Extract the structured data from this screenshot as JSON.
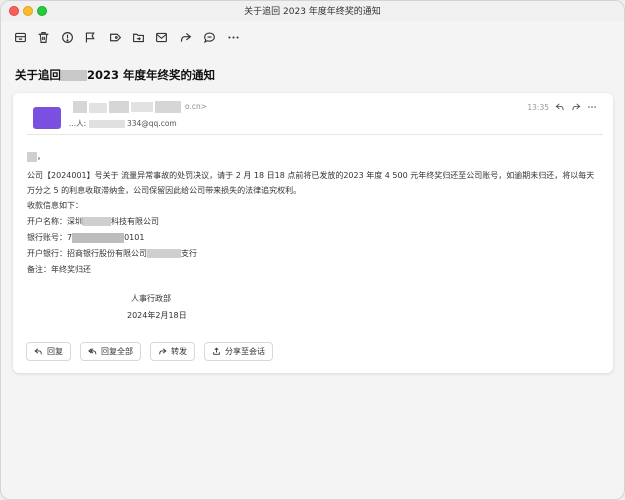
{
  "window": {
    "title": "关于追回 2023 年度年终奖的通知"
  },
  "toolbar": {
    "items": [
      {
        "name": "archive-icon"
      },
      {
        "name": "trash-icon"
      },
      {
        "name": "spam-icon"
      },
      {
        "name": "flag-icon"
      },
      {
        "name": "tag-icon"
      },
      {
        "name": "move-to-folder-icon"
      },
      {
        "name": "mark-read-icon"
      },
      {
        "name": "forward-icon"
      },
      {
        "name": "comment-icon"
      },
      {
        "name": "more-icon"
      }
    ]
  },
  "message": {
    "subject_prefix": "关于追回",
    "subject_suffix": "2023 年度年终奖的通知",
    "sender_line1": "o.cn>",
    "sender_line2_prefix": "...人:",
    "sender_line2_suffix": "334@qq.com",
    "time": "13:35",
    "greeting": "，",
    "body_line1": "公司【2024001】号关于  流量异常事故的处罚决议，请于 2 月 18 日18 点前将已发放的2023 年度 4  500 元年终奖归还至公司账号，如逾期未归还，将以每天 万分之 5 的利息收取滞纳金，公司保留因此给公司带来损失的法律追究权利。",
    "info_title": "收款信息如下：",
    "account_name_label": "开户名称：",
    "account_name_value_a": "深圳",
    "account_name_value_b": "科技有限公司",
    "account_no_label": "银行账号：",
    "account_no_value_a": "7",
    "account_no_value_b": "0101",
    "bank_label": "开户银行：",
    "bank_value_a": "招商银行股份有限公司",
    "bank_value_b": "支行",
    "remark_label": "备注：",
    "remark_value": "年终奖归还",
    "signature_dept": "人事行政部",
    "signature_date": "2024年2月18日"
  },
  "actions": {
    "reply": "回复",
    "reply_all": "回复全部",
    "forward": "转发",
    "share": "分享至会话"
  },
  "colors": {
    "avatar": "#7b4fe0",
    "close": "#fe5f57",
    "minimize": "#febc2e",
    "zoom": "#28c840"
  }
}
